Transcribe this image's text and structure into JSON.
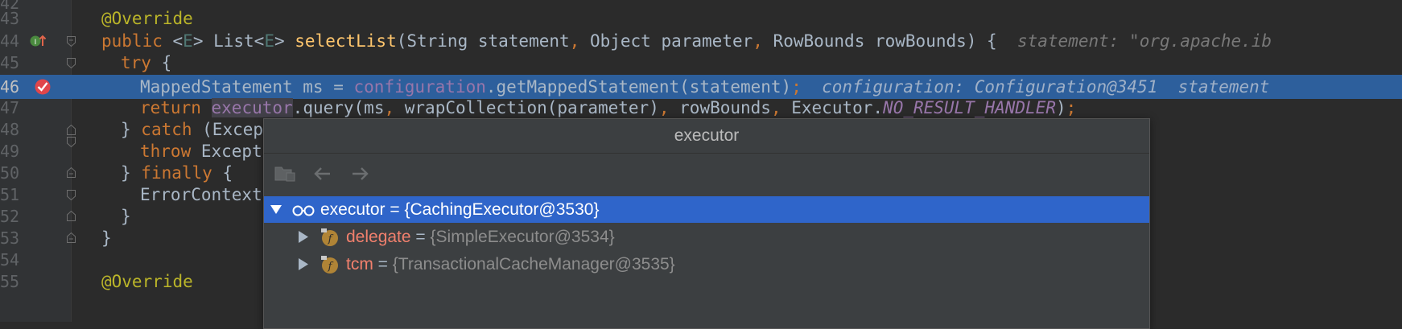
{
  "editor": {
    "lines": [
      {
        "num": "42",
        "code": ""
      },
      {
        "num": "43",
        "code": "@Override"
      },
      {
        "num": "44",
        "code": "public <E> List<E> selectList(String statement, Object parameter, RowBounds rowBounds) {",
        "hint": "statement: \"org.apache.ib"
      },
      {
        "num": "45",
        "code": "try {"
      },
      {
        "num": "46",
        "code": "MappedStatement ms = configuration.getMappedStatement(statement);",
        "hint": "configuration: Configuration@3451  statement"
      },
      {
        "num": "47",
        "code": "return executor.query(ms, wrapCollection(parameter), rowBounds, Executor.NO_RESULT_HANDLER);"
      },
      {
        "num": "48",
        "code": "} catch (Excep"
      },
      {
        "num": "49",
        "code": "throw Except"
      },
      {
        "num": "50",
        "code": "} finally {"
      },
      {
        "num": "51",
        "code": "ErrorContext"
      },
      {
        "num": "52",
        "code": "}"
      },
      {
        "num": "53",
        "code": "}"
      },
      {
        "num": "54",
        "code": ""
      },
      {
        "num": "55",
        "code": "@Override"
      }
    ]
  },
  "popup": {
    "title": "executor",
    "toolbar": {
      "open_icon": "folder-view-icon",
      "back_icon": "arrow-left-icon",
      "forward_icon": "arrow-right-icon"
    },
    "root": {
      "name": "executor",
      "eq": " = ",
      "value": "{CachingExecutor@3530}",
      "icon": "watch-glasses-icon"
    },
    "children": [
      {
        "name": "delegate",
        "eq": " = ",
        "value": "{SimpleExecutor@3534}",
        "icon": "field-f-icon"
      },
      {
        "name": "tcm",
        "eq": " = ",
        "value": "{TransactionalCacheManager@3535}",
        "icon": "field-f-icon"
      }
    ]
  },
  "colors": {
    "selection": "#2f65ca",
    "current_line": "#2d5f9c",
    "breakpoint": "#e0464b"
  }
}
